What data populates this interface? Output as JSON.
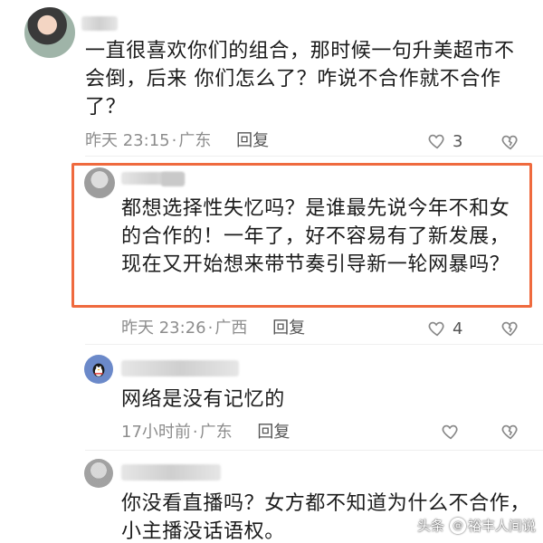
{
  "comments": [
    {
      "text": "一直很喜欢你们的组合，那时候一句升美超市不会倒，后来 你们怎么了？咋说不合作就不合作了？",
      "time": "昨天 23:15",
      "location": "广东",
      "reply_label": "回复",
      "likes": "3"
    },
    {
      "text": "都想选择性失忆吗？是谁最先说今年不和女的合作的！一年了，好不容易有了新发展，现在又开始想来带节奏引导新一轮网暴吗？",
      "time": "昨天 23:26",
      "location": "广西",
      "reply_label": "回复",
      "likes": "4"
    },
    {
      "text": "网络是没有记忆的",
      "time": "17小时前",
      "location": "广东",
      "reply_label": "回复",
      "likes": ""
    },
    {
      "text": "你没看直播吗？女方都不知道为什么不合作，小主播没话语权。"
    }
  ],
  "watermark": {
    "platform": "头条",
    "author": "裕丰人间说"
  },
  "colors": {
    "highlight": "#ef6a3e",
    "meta": "#8d8d8d",
    "text": "#1b1b1b"
  }
}
